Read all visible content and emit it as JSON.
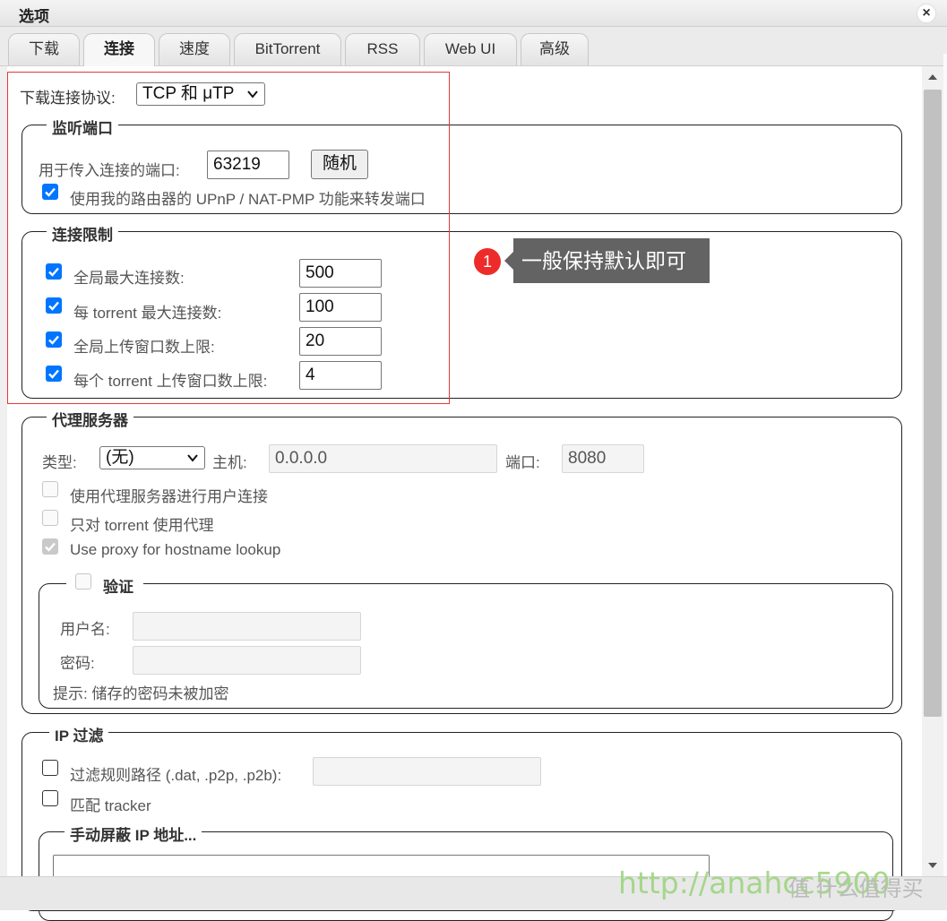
{
  "window": {
    "title": "选项",
    "close_glyph": "×"
  },
  "tabs": [
    {
      "label": "下载",
      "active": false
    },
    {
      "label": "连接",
      "active": true
    },
    {
      "label": "速度",
      "active": false
    },
    {
      "label": "BitTorrent",
      "active": false
    },
    {
      "label": "RSS",
      "active": false
    },
    {
      "label": "Web UI",
      "active": false
    },
    {
      "label": "高级",
      "active": false
    }
  ],
  "protocol": {
    "label": "下载连接协议:",
    "value": "TCP 和 μTP"
  },
  "listen_port": {
    "legend": "监听端口",
    "port_label": "用于传入连接的端口:",
    "port_value": "63219",
    "random_button": "随机",
    "upnp_label": "使用我的路由器的 UPnP / NAT-PMP 功能来转发端口",
    "upnp_checked": true
  },
  "limits": {
    "legend": "连接限制",
    "rows": [
      {
        "label": "全局最大连接数:",
        "value": "500",
        "checked": true
      },
      {
        "label": "每 torrent 最大连接数:",
        "value": "100",
        "checked": true
      },
      {
        "label": "全局上传窗口数上限:",
        "value": "20",
        "checked": true
      },
      {
        "label": "每个 torrent 上传窗口数上限:",
        "value": "4",
        "checked": true
      }
    ]
  },
  "annotation": {
    "badge": "1",
    "text": "一般保持默认即可"
  },
  "proxy": {
    "legend": "代理服务器",
    "type_label": "类型:",
    "type_value": "(无)",
    "host_label": "主机:",
    "host_value": "0.0.0.0",
    "port_label": "端口:",
    "port_value": "8080",
    "peer_label": "使用代理服务器进行用户连接",
    "torrent_only_label": "只对 torrent 使用代理",
    "hostname_label": "Use proxy for hostname lookup",
    "hostname_checked": true
  },
  "auth": {
    "legend": "验证",
    "username_label": "用户名:",
    "password_label": "密码:",
    "hint": "提示: 储存的密码未被加密"
  },
  "ip_filter": {
    "legend": "IP 过滤",
    "path_label": "过滤规则路径 (.dat, .p2p, .p2b):",
    "tracker_label": "匹配 tracker",
    "manual_legend": "手动屏蔽 IP 地址..."
  },
  "watermark": {
    "url": "http://anahcc5900",
    "site": "值 什么值得买"
  },
  "colors": {
    "accent": "#0075ff",
    "highlight_box": "#e53935",
    "badge": "#ee2b2b",
    "tooltip": "#636363"
  }
}
